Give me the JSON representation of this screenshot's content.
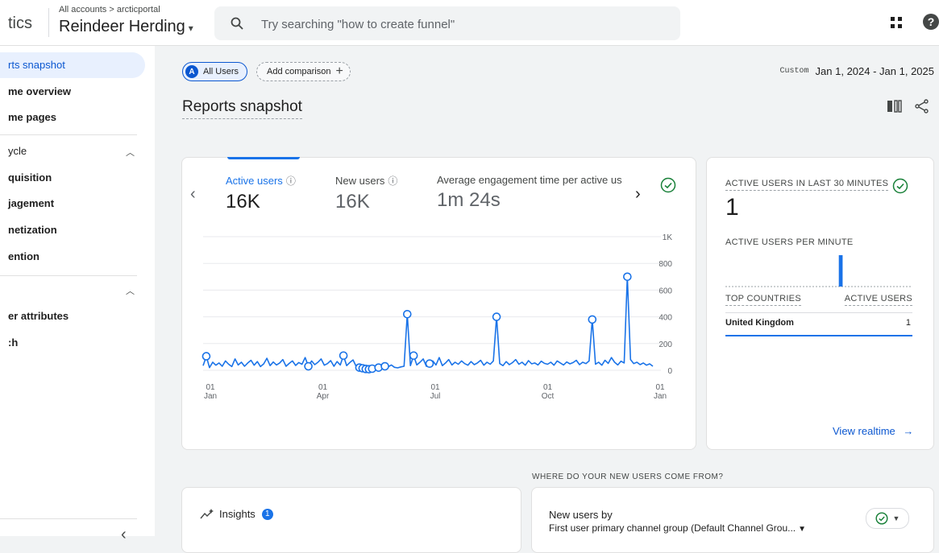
{
  "header": {
    "app_name": "tics",
    "breadcrumb": "All accounts > arcticportal",
    "property_name": "Reindeer Herding",
    "search_placeholder": "Try searching \"how to create funnel\""
  },
  "sidebar": {
    "items": [
      {
        "label": "rts snapshot"
      },
      {
        "label": "me overview"
      },
      {
        "label": "me pages"
      },
      {
        "label": "ycle"
      },
      {
        "label": "quisition"
      },
      {
        "label": "jagement"
      },
      {
        "label": "netization"
      },
      {
        "label": "ention"
      },
      {
        "label": "er attributes"
      },
      {
        "label": ":h"
      }
    ],
    "chevron_bottom": "‹"
  },
  "toolbar": {
    "all_users_badge": "A",
    "all_users_label": "All Users",
    "add_comparison_label": "Add comparison",
    "date_custom_label": "Custom",
    "date_range": "Jan 1, 2024 - Jan 1, 2025"
  },
  "page_title": "Reports snapshot",
  "metrics": [
    {
      "label": "Active users",
      "value": "16K"
    },
    {
      "label": "New users",
      "value": "16K"
    },
    {
      "label": "Average engagement time per active us",
      "value": "1m 24s"
    }
  ],
  "realtime": {
    "title": "ACTIVE USERS IN LAST 30 MINUTES",
    "value": "1",
    "per_minute_label": "ACTIVE USERS PER MINUTE",
    "col_countries": "TOP COUNTRIES",
    "col_users": "ACTIVE USERS",
    "rows": [
      {
        "country": "United Kingdom",
        "users": "1"
      }
    ],
    "link": "View realtime"
  },
  "bottom": {
    "section_label": "WHERE DO YOUR NEW USERS COME FROM?",
    "insights_label": "Insights",
    "insights_count": "1",
    "new_users_title": "New users by",
    "new_users_dimension": "First user primary channel group (Default Channel Grou..."
  },
  "colors": {
    "accent": "#1a73e8",
    "check": "#188038"
  },
  "chart_data": {
    "type": "line",
    "series": [
      {
        "values": [
          35,
          105,
          20,
          60,
          38,
          55,
          30,
          70,
          45,
          28,
          85,
          40,
          60,
          30,
          55,
          75,
          38,
          65,
          28,
          48,
          90,
          35,
          62,
          40,
          55,
          80,
          30,
          52,
          70,
          36,
          58,
          45,
          95,
          30,
          70,
          42,
          60,
          85,
          38,
          50,
          72,
          30,
          65,
          40,
          110,
          35,
          58,
          78,
          28,
          20,
          15,
          10,
          8,
          12,
          8,
          20,
          15,
          30,
          25,
          40,
          22,
          18,
          25,
          30,
          420,
          35,
          110,
          40,
          60,
          85,
          30,
          50,
          70,
          40,
          95,
          35,
          55,
          80,
          40,
          60,
          45,
          70,
          50,
          38,
          65,
          42,
          55,
          75,
          38,
          60,
          45,
          70,
          400,
          50,
          35,
          65,
          42,
          58,
          80,
          45,
          60,
          38,
          72,
          48,
          55,
          40,
          68,
          52,
          45,
          60,
          38,
          70,
          55,
          40,
          62,
          48,
          58,
          75,
          42,
          60,
          50,
          70,
          380,
          45,
          60,
          38,
          75,
          52,
          95,
          60,
          40,
          68,
          55,
          700,
          80,
          50,
          60,
          42,
          55,
          38,
          48,
          30
        ]
      }
    ],
    "y_ticks": [
      "0",
      "200",
      "400",
      "600",
      "800",
      "1K"
    ],
    "ylim": [
      0,
      1000
    ],
    "x_ticks": [
      {
        "day": "01",
        "month": "Jan"
      },
      {
        "day": "01",
        "month": "Apr"
      },
      {
        "day": "01",
        "month": "Jul"
      },
      {
        "day": "01",
        "month": "Oct"
      },
      {
        "day": "01",
        "month": "Jan"
      }
    ],
    "anomalies": [
      1,
      33,
      44,
      49,
      50,
      51,
      52,
      53,
      55,
      57,
      64,
      66,
      71,
      92,
      122,
      133
    ],
    "realtime_bars": [
      0,
      0,
      0,
      0,
      0,
      0,
      0,
      0,
      0,
      0,
      0,
      0,
      0,
      0,
      0,
      0,
      0,
      0,
      1,
      0,
      0,
      0,
      0,
      0,
      0,
      0,
      0,
      0,
      0,
      0
    ]
  }
}
